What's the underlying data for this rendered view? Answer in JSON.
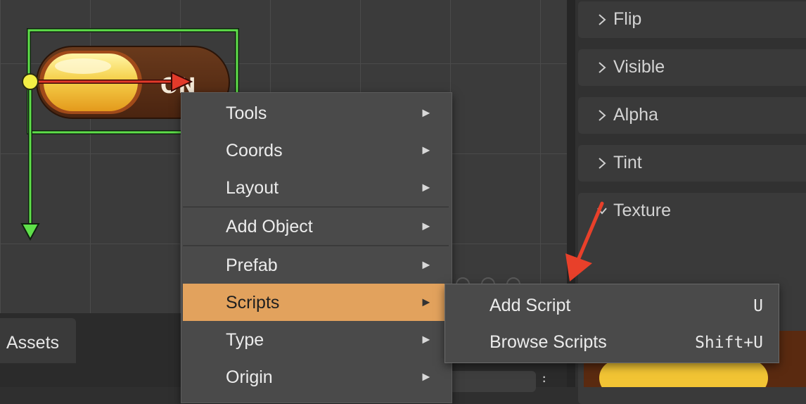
{
  "canvas": {
    "toggle_text": "ON"
  },
  "inspector": {
    "sections": [
      {
        "label": "Flip"
      },
      {
        "label": "Visible"
      },
      {
        "label": "Alpha"
      },
      {
        "label": "Tint"
      },
      {
        "label": "Texture"
      }
    ]
  },
  "bottom": {
    "assets_tab": "Assets"
  },
  "context_menu": {
    "items": [
      {
        "label": "Tools",
        "arrow": "►"
      },
      {
        "label": "Coords",
        "arrow": "►"
      },
      {
        "label": "Layout",
        "arrow": "►"
      },
      {
        "label": "Add Object",
        "arrow": "►"
      },
      {
        "label": "Prefab",
        "arrow": "►"
      },
      {
        "label": "Scripts",
        "arrow": "►"
      },
      {
        "label": "Type",
        "arrow": "►"
      },
      {
        "label": "Origin",
        "arrow": "►"
      }
    ],
    "active_item": "Scripts"
  },
  "scripts_submenu": {
    "items": [
      {
        "label": "Add Script",
        "shortcut": "U"
      },
      {
        "label": "Browse Scripts",
        "shortcut": "Shift+U"
      }
    ]
  },
  "colors": {
    "menu_highlight": "#e2a25d",
    "gizmo_green": "#5fe04a",
    "gizmo_red": "#e23a2a",
    "annotation_arrow": "#e8402a"
  }
}
